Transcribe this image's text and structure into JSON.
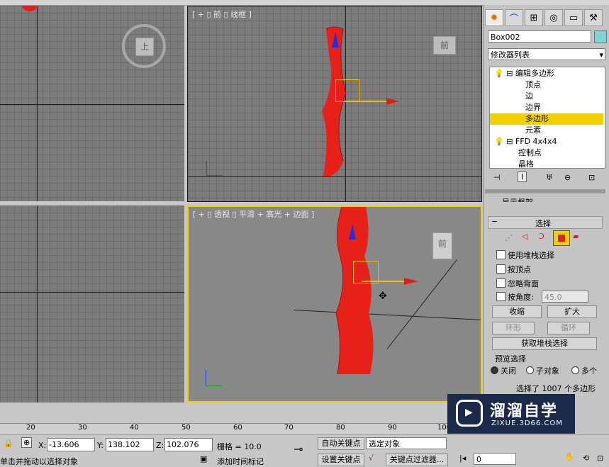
{
  "viewports": {
    "front_label": "[ + ▯ 前 ▯ 线框 ]",
    "persp_label": "[ + ▯ 透视 ▯ 平滑 + 高光 + 边面 ]",
    "viewcube_top": "上",
    "viewcube_front": "前",
    "viewcube_persp": "前"
  },
  "panel": {
    "tabs": [
      "create-icon",
      "modify-icon",
      "hierarchy-icon",
      "motion-icon",
      "display-icon",
      "utilities-icon"
    ],
    "object_name": "Box002",
    "object_color": "#7fd4d4",
    "modifier_list": "修改器列表",
    "stack": [
      {
        "label": "编辑多边形",
        "level": 0
      },
      {
        "label": "顶点",
        "level": 1
      },
      {
        "label": "边",
        "level": 1
      },
      {
        "label": "边界",
        "level": 1
      },
      {
        "label": "多边形",
        "level": 1,
        "selected": true
      },
      {
        "label": "元素",
        "level": 1
      },
      {
        "label": "FFD 4x4x4",
        "level": 0
      },
      {
        "label": "控制点",
        "level": 1
      },
      {
        "label": "晶格",
        "level": 1
      }
    ],
    "partial_row": "显示框架",
    "selection_title": "选择",
    "use_stack": "使用堆栈选择",
    "by_vertex": "按顶点",
    "ignore_back": "忽略背面",
    "by_angle": "按角度:",
    "angle_value": "45.0",
    "shrink": "收缩",
    "grow": "扩大",
    "ring": "环形",
    "loop": "循环",
    "get_stack": "获取堆栈选择",
    "preview_title": "预览选择",
    "preview_off": "关闭",
    "preview_sub": "子对象",
    "preview_multi": "多个",
    "selected_info": "选择了 1007 个多边形"
  },
  "timeline": {
    "ticks": [
      "20",
      "30",
      "40",
      "50",
      "60",
      "70",
      "80",
      "90",
      "100"
    ]
  },
  "statusbar": {
    "prompt": "单击并拖动以选择对象",
    "x_label": "X:",
    "x_value": "-13.606",
    "y_label": "Y:",
    "y_value": "138.102",
    "z_label": "Z:",
    "z_value": "102.076",
    "grid": "栅格 = 10.0",
    "auto_key": "自动关键点",
    "set_key": "设置关键点",
    "selected_object": "选定对象",
    "key_filter": "关键点过滤器...",
    "add_time_tag": "添加时间标记",
    "frame_value": "0"
  },
  "watermark": {
    "title": "溜溜自学",
    "url": "ZIXUE.3D66.COM"
  }
}
